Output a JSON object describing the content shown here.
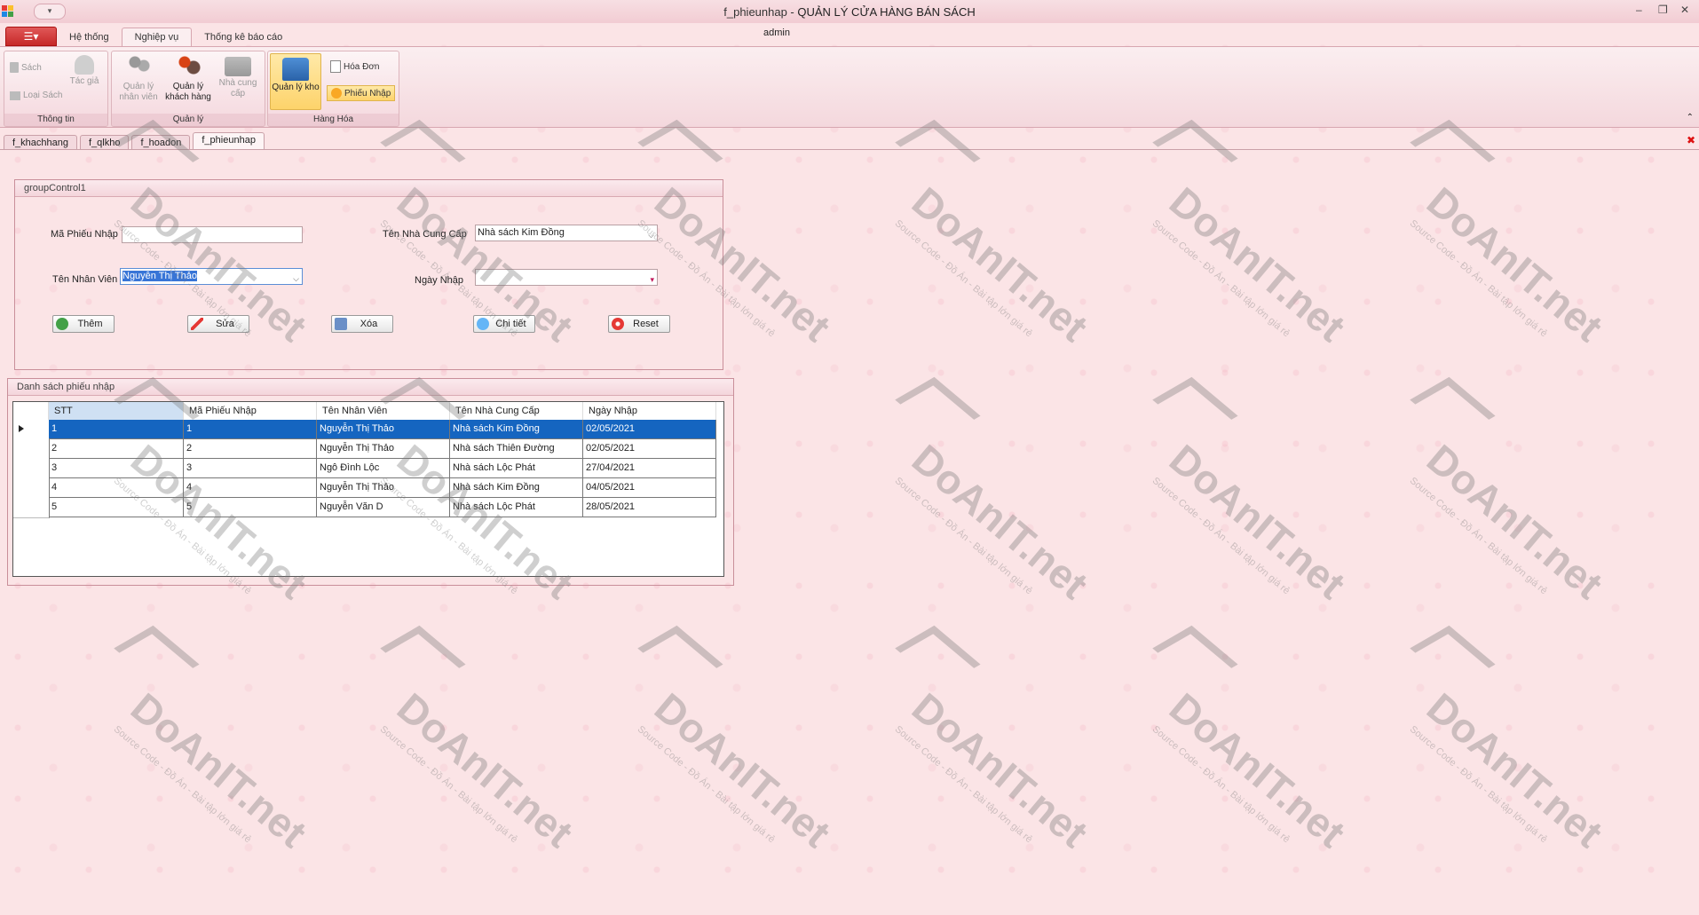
{
  "window": {
    "title_prefix": "f_phieunhap - ",
    "title_app": "QUẢN LÝ CỬA HÀNG BÁN SÁCH",
    "user": "admin",
    "qat_label": "▾"
  },
  "ribbon": {
    "tabs": [
      "Hệ thống",
      "Nghiệp vụ",
      "Thống kê báo cáo"
    ],
    "groups": {
      "thong_tin": {
        "label": "Thông tin",
        "sach": "Sách",
        "tac_gia": "Tác giả",
        "loai_sach": "Loại Sách"
      },
      "quan_ly": {
        "label": "Quản lý",
        "nhan_vien": "Quản lý nhân viên",
        "khach_hang": "Quản lý khách hàng",
        "nha_cung_cap": "Nhà cung cấp"
      },
      "hang_hoa": {
        "label": "Hàng Hóa",
        "kho": "Quản lý kho",
        "hoa_don": "Hóa Đơn",
        "phieu_nhap": "Phiếu Nhập"
      }
    }
  },
  "doc_tabs": [
    "f_khachhang",
    "f_qlkho",
    "f_hoadon",
    "f_phieunhap"
  ],
  "form": {
    "group_title": "groupControl1",
    "ma_phieu_nhap_label": "Mã Phiếu Nhập",
    "ma_phieu_nhap_value": "",
    "ten_ncc_label": "Tên Nhà Cung Cấp",
    "ten_ncc_value": "Nhà sách Kim Đồng",
    "ten_nv_label": "Tên Nhân Viên",
    "ten_nv_value": "Nguyễn Thị Thảo",
    "ngay_nhap_label": "Ngày Nhập",
    "ngay_nhap_value": "",
    "buttons": {
      "them": "Thêm",
      "sua": "Sửa",
      "xoa": "Xóa",
      "chitiet": "Chi tiết",
      "reset": "Reset"
    }
  },
  "list": {
    "title": "Danh sách phiếu nhập",
    "columns": [
      "STT",
      "Mã Phiếu Nhập",
      "Tên Nhân Viên",
      "Tên Nhà Cung Cấp",
      "Ngày Nhập"
    ],
    "rows": [
      [
        "1",
        "1",
        "Nguyễn Thị Thảo",
        "Nhà sách Kim Đồng",
        "02/05/2021"
      ],
      [
        "2",
        "2",
        "Nguyễn Thị Thảo",
        "Nhà sách Thiên Đường",
        "02/05/2021"
      ],
      [
        "3",
        "3",
        "Ngô Đình Lộc",
        "Nhà sách Lộc Phát",
        "27/04/2021"
      ],
      [
        "4",
        "4",
        "Nguyễn Thị Thảo",
        "Nhà sách Kim Đồng",
        "04/05/2021"
      ],
      [
        "5",
        "5",
        "Nguyễn Văn D",
        "Nhà sách Lộc Phát",
        "28/05/2021"
      ]
    ]
  },
  "watermark": {
    "brand": "DoAnIT.net",
    "tagline": "Source Code - Đồ Án - Bài tập lớn giá rẻ"
  },
  "colors": {
    "selection": "#1565c0",
    "accent": "#c62828",
    "background": "#fbe4e6"
  }
}
